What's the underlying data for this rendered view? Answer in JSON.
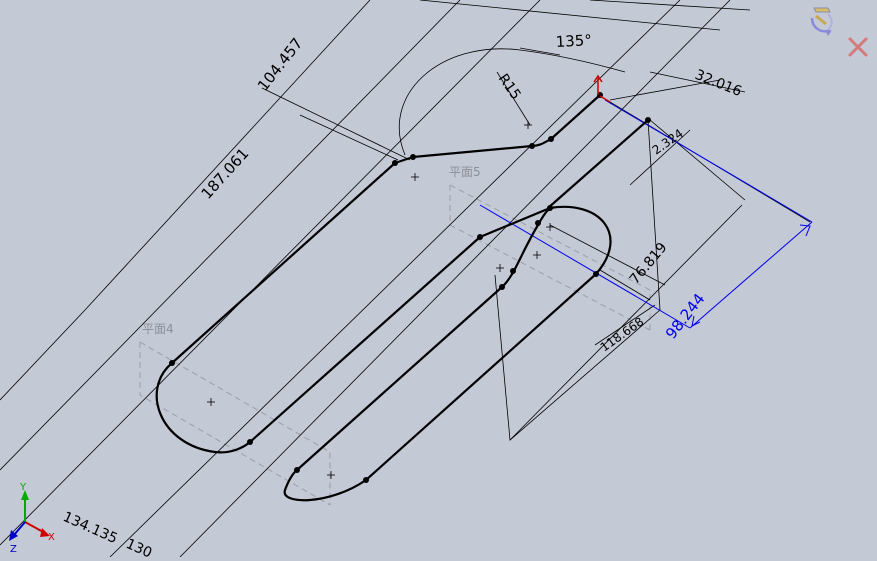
{
  "colors": {
    "background": "#c4c9d6",
    "sketch_line": "#000000",
    "dimension_line": "#000000",
    "active_dimension": "#0000ee",
    "plane_outline": "#9aa0aa",
    "plane_label": "#8a9099",
    "axis_x": "#cc0000",
    "axis_y": "#00aa00",
    "axis_z": "#0000cc",
    "close_button": "#d47a7a"
  },
  "dimensions": {
    "d1": "104.457",
    "d2": "135°",
    "d3": "R15",
    "d4": "32.016",
    "d5": "187.061",
    "d6": "2.324",
    "d7": "76.819",
    "d8": "118.668",
    "d9": "98.244",
    "d10": "134.135",
    "d11": "130"
  },
  "planes": {
    "plane4": "平面4",
    "plane5": "平面5"
  },
  "triad": {
    "x": "X",
    "y": "Y",
    "z": "Z"
  },
  "icons": {
    "confirm_corner": "rebuild-confirm-icon",
    "cancel_corner": "close-icon"
  }
}
